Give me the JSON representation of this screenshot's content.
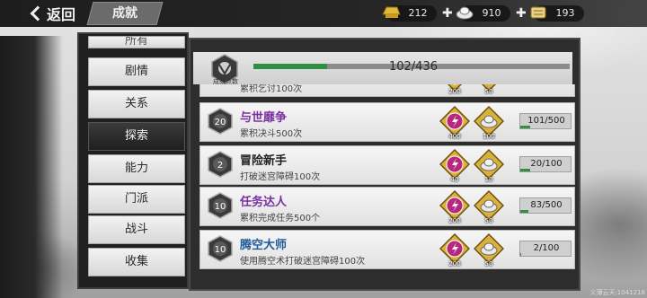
{
  "header": {
    "back_label": "返回",
    "tab_title": "成就",
    "currencies": [
      {
        "icon": "gold-ingot-icon",
        "value": "212"
      },
      {
        "icon": "silver-ingot-icon",
        "value": "910"
      },
      {
        "icon": "scroll-icon",
        "value": "193"
      }
    ]
  },
  "nav": {
    "items": [
      {
        "label": "所有",
        "state": "partial"
      },
      {
        "label": "剧情",
        "state": "normal"
      },
      {
        "label": "关系",
        "state": "normal"
      },
      {
        "label": "探索",
        "state": "active"
      },
      {
        "label": "能力",
        "state": "normal"
      },
      {
        "label": "门派",
        "state": "normal"
      },
      {
        "label": "战斗",
        "state": "normal"
      },
      {
        "label": "收集",
        "state": "normal"
      }
    ]
  },
  "points": {
    "label": "成就点数",
    "current": 102,
    "max": 436,
    "text": "102/436"
  },
  "achievements": [
    {
      "badge_level": "",
      "title": "",
      "desc": "累积乞讨100次",
      "title_color": "dark",
      "rewards": [
        "200",
        "50"
      ],
      "progress": "",
      "fraction": 0
    },
    {
      "badge_level": "20",
      "title": "与世靡争",
      "desc": "累积决斗500次",
      "title_color": "purple",
      "rewards": [
        "400",
        "100"
      ],
      "progress": "101/500",
      "fraction": 0.202
    },
    {
      "badge_level": "2",
      "title": "冒险新手",
      "desc": "打破迷宫障碍100次",
      "title_color": "dark",
      "rewards": [
        "40",
        "10"
      ],
      "progress": "20/100",
      "fraction": 0.2
    },
    {
      "badge_level": "10",
      "title": "任务达人",
      "desc": "累积完成任务500个",
      "title_color": "purple",
      "rewards": [
        "200",
        "50"
      ],
      "progress": "83/500",
      "fraction": 0.166
    },
    {
      "badge_level": "10",
      "title": "腾空大师",
      "desc": "使用腾空术打破迷宫障碍100次",
      "title_color": "blue",
      "rewards": [
        "200",
        "50"
      ],
      "progress": "2/100",
      "fraction": 0.02
    }
  ],
  "footer": {
    "server": "义薄云天:1041218"
  },
  "colors": {
    "progress_green": "#2f8f45",
    "title_purple": "#7a2fa0",
    "title_blue": "#1f5a9a",
    "nav_active": "#1f1f1f"
  }
}
